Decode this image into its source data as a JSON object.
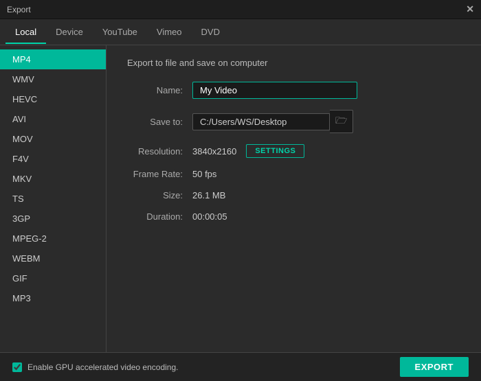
{
  "titleBar": {
    "title": "Export",
    "closeLabel": "✕"
  },
  "tabs": [
    {
      "id": "local",
      "label": "Local",
      "active": true
    },
    {
      "id": "device",
      "label": "Device",
      "active": false
    },
    {
      "id": "youtube",
      "label": "YouTube",
      "active": false
    },
    {
      "id": "vimeo",
      "label": "Vimeo",
      "active": false
    },
    {
      "id": "dvd",
      "label": "DVD",
      "active": false
    }
  ],
  "sidebar": {
    "items": [
      {
        "id": "mp4",
        "label": "MP4",
        "active": true
      },
      {
        "id": "wmv",
        "label": "WMV",
        "active": false
      },
      {
        "id": "hevc",
        "label": "HEVC",
        "active": false
      },
      {
        "id": "avi",
        "label": "AVI",
        "active": false
      },
      {
        "id": "mov",
        "label": "MOV",
        "active": false
      },
      {
        "id": "f4v",
        "label": "F4V",
        "active": false
      },
      {
        "id": "mkv",
        "label": "MKV",
        "active": false
      },
      {
        "id": "ts",
        "label": "TS",
        "active": false
      },
      {
        "id": "3gp",
        "label": "3GP",
        "active": false
      },
      {
        "id": "mpeg2",
        "label": "MPEG-2",
        "active": false
      },
      {
        "id": "webm",
        "label": "WEBM",
        "active": false
      },
      {
        "id": "gif",
        "label": "GIF",
        "active": false
      },
      {
        "id": "mp3",
        "label": "MP3",
        "active": false
      }
    ]
  },
  "content": {
    "heading": "Export to file and save on computer",
    "form": {
      "nameLabel": "Name:",
      "nameValue": "My Video",
      "namePlaceholder": "My Video",
      "saveToLabel": "Save to:",
      "saveToValue": "C:/Users/WS/Desktop",
      "folderIcon": "🗁",
      "resolutionLabel": "Resolution:",
      "resolutionValue": "3840x2160",
      "settingsLabel": "SETTINGS",
      "frameRateLabel": "Frame Rate:",
      "frameRateValue": "50 fps",
      "sizeLabel": "Size:",
      "sizeValue": "26.1 MB",
      "durationLabel": "Duration:",
      "durationValue": "00:00:05"
    }
  },
  "bottomBar": {
    "checkboxLabel": "Enable GPU accelerated video encoding.",
    "exportLabel": "EXPORT"
  }
}
